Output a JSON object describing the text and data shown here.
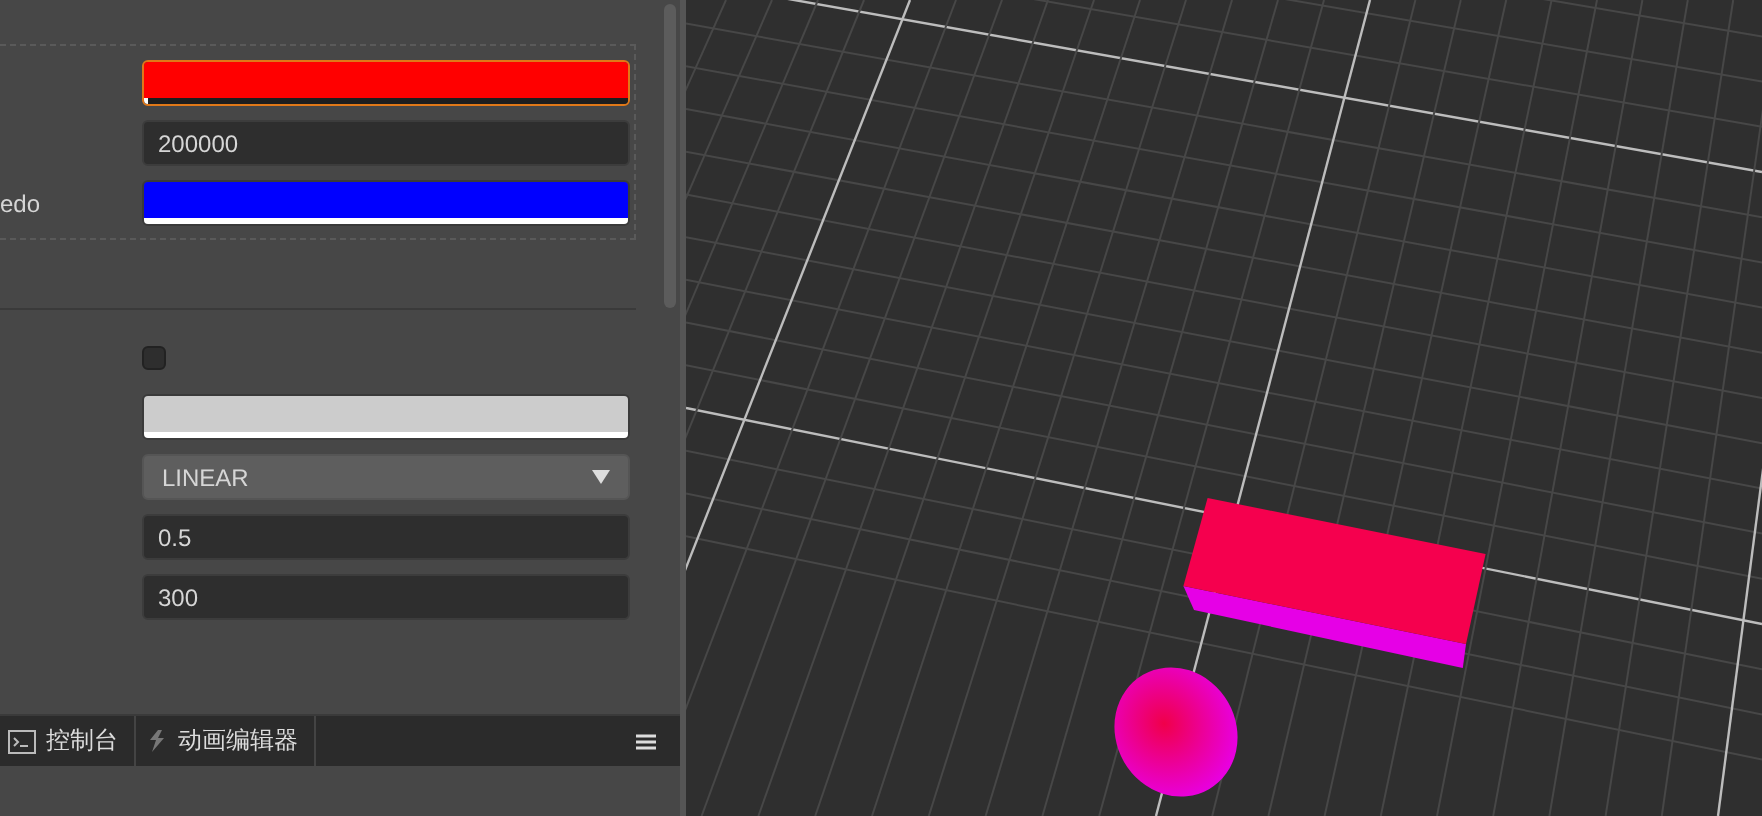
{
  "inspector": {
    "sections": [
      {
        "bordered": true,
        "rows": [
          {
            "kind": "color",
            "label": "",
            "color": "#ff0000",
            "level": 0.01,
            "focused": true
          },
          {
            "kind": "number",
            "label": "",
            "value": "200000"
          },
          {
            "kind": "color",
            "label": "edo",
            "color": "#0000ff",
            "level": 1,
            "focused": false
          }
        ]
      },
      {
        "bordered": false,
        "rows": [
          {
            "kind": "checkbox",
            "label": "",
            "checked": false
          },
          {
            "kind": "color",
            "label": "",
            "color": "#cccccc",
            "level": 1,
            "focused": false
          },
          {
            "kind": "select",
            "label": "",
            "value": "LINEAR"
          },
          {
            "kind": "number",
            "label": "",
            "value": "0.5"
          },
          {
            "kind": "number",
            "label": "",
            "value": "300"
          }
        ]
      }
    ]
  },
  "bottom_tabs": [
    {
      "label": "控制台",
      "kind": "console",
      "selected": false
    },
    {
      "label": "动画编辑器",
      "kind": "animation",
      "selected": false
    }
  ]
}
